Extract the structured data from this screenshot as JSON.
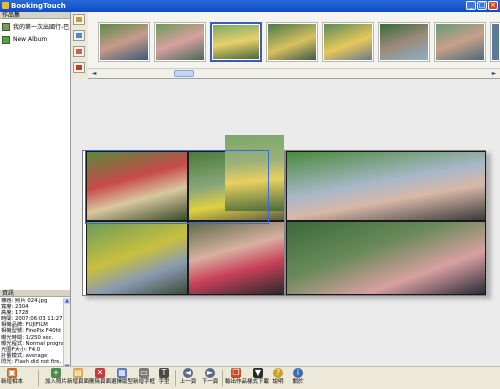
{
  "window": {
    "title": "BookingTouch"
  },
  "left_panel": {
    "header": "作品集",
    "albums": [
      {
        "icon": "album-icon",
        "label": "我的第一次出國行-巴里島"
      },
      {
        "icon": "new-album-icon",
        "label": "New Album"
      }
    ],
    "properties_header": "資訊",
    "properties": [
      "標題: 照片 024.jpg",
      "寬度: 2304",
      "高度: 1728",
      "時間: 2007:06:03 11:27:40",
      "相機品牌: FUJIFILM",
      "相機型號: FinePix F40fd",
      "曝光時間: 1/250 sec.",
      "曝光程式: Normal program",
      "光圈F大小: F4.0",
      "計量模式: average",
      "閃光: Flash did not fire, com"
    ]
  },
  "filmstrip": {
    "thumbnail_count": 8,
    "selected_index": 2
  },
  "toolbar": {
    "buttons": [
      {
        "key": "new_book",
        "label": "新增相本",
        "icon": "book-icon"
      },
      {
        "key": "add_photo",
        "label": "加入照片",
        "icon": "add-photo-icon"
      },
      {
        "key": "new_page",
        "label": "新增頁面",
        "icon": "new-page-icon"
      },
      {
        "key": "delete_page",
        "label": "刪除頁面",
        "icon": "delete-page-icon"
      },
      {
        "key": "choose_layout",
        "label": "選擇版型",
        "icon": "layout-icon"
      },
      {
        "key": "new_text",
        "label": "新增字框",
        "icon": "text-frame-icon"
      },
      {
        "key": "font",
        "label": "字型",
        "icon": "font-icon"
      },
      {
        "key": "prev_page",
        "label": "上一頁",
        "icon": "arrow-left-icon"
      },
      {
        "key": "next_page",
        "label": "下一頁",
        "icon": "arrow-right-icon"
      },
      {
        "key": "export_work",
        "label": "輸出作品",
        "icon": "export-icon"
      },
      {
        "key": "style_download",
        "label": "樣式下載",
        "icon": "download-icon"
      },
      {
        "key": "help",
        "label": "說明",
        "icon": "help-icon"
      },
      {
        "key": "about",
        "label": "關於",
        "icon": "info-icon"
      }
    ]
  },
  "colors": {
    "titlebar": "#0a4cc8",
    "selection": "#3a6ad8",
    "workspace": "#ebebeb"
  }
}
